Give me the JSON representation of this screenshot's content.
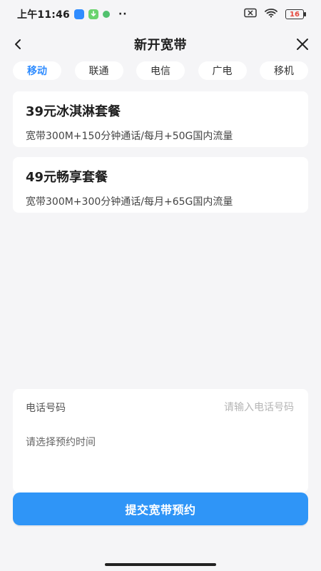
{
  "status_bar": {
    "time": "上午11:46",
    "battery_level": "16",
    "icons": [
      "blue-app-icon",
      "green-download-icon",
      "green-dot-icon",
      "sim-blocked-icon",
      "wifi-icon",
      "battery-icon"
    ]
  },
  "header": {
    "title": "新开宽带"
  },
  "tabs": [
    {
      "label": "移动",
      "active": true
    },
    {
      "label": "联通"
    },
    {
      "label": "电信"
    },
    {
      "label": "广电"
    },
    {
      "label": "移机"
    }
  ],
  "plans": [
    {
      "title": "39元冰淇淋套餐",
      "desc": "宽带300M+150分钟通话/每月+50G国内流量"
    },
    {
      "title": "49元畅享套餐",
      "desc": "宽带300M+300分钟通话/每月+65G国内流量"
    }
  ],
  "form": {
    "phone_label": "电话号码",
    "phone_placeholder": "请输入电话号码",
    "time_label": "请选择预约时间"
  },
  "actions": {
    "submit_label": "提交宽带预约"
  },
  "colors": {
    "accent": "#2f95f7",
    "background": "#f5f5f7",
    "card": "#ffffff",
    "battery_low": "#e5483d"
  }
}
